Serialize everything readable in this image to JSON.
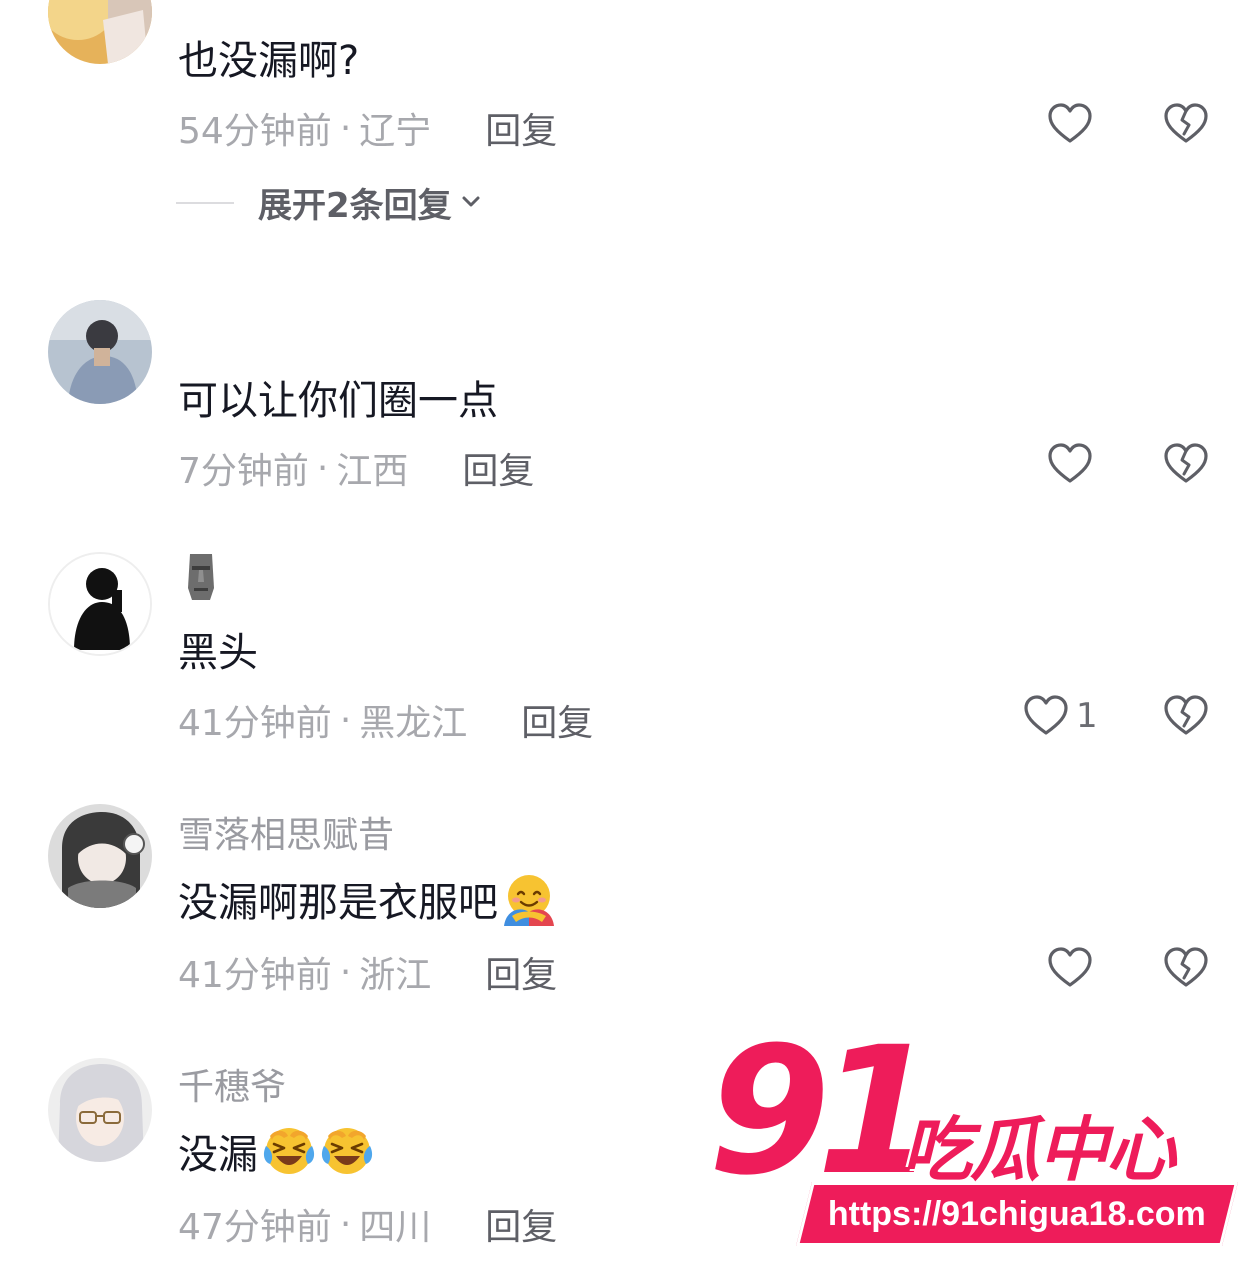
{
  "comments": [
    {
      "username": "",
      "text": "也没漏啊?",
      "time": "54分钟前",
      "location": "辽宁",
      "reply_label": "回复",
      "like_count": "",
      "expand": "展开2条回复"
    },
    {
      "username": "",
      "text": "可以让你们圈一点",
      "time": "7分钟前",
      "location": "江西",
      "reply_label": "回复",
      "like_count": ""
    },
    {
      "username": "",
      "text": "黑头",
      "time": "41分钟前",
      "location": "黑龙江",
      "reply_label": "回复",
      "like_count": "1"
    },
    {
      "username": "雪落相思赋昔",
      "text": "没漏啊那是衣服吧",
      "time": "41分钟前",
      "location": "浙江",
      "reply_label": "回复",
      "like_count": ""
    },
    {
      "username": "千穗爷",
      "text": "没漏",
      "time": "47分钟前",
      "location": "四川",
      "reply_label": "回复",
      "like_count": ""
    }
  ],
  "separator": "·",
  "icons": {
    "like": "heart-outline-icon",
    "dislike": "broken-heart-icon",
    "expand": "chevron-down-icon",
    "chevron": "⌄"
  },
  "watermark": {
    "logo_number": "91",
    "logo_text": "吃瓜中心",
    "url": "https://91chigua18.com"
  },
  "colors": {
    "accent": "#ee1c5a",
    "meta_gray": "#a7a8ad",
    "reply_gray": "#5e5f66"
  }
}
